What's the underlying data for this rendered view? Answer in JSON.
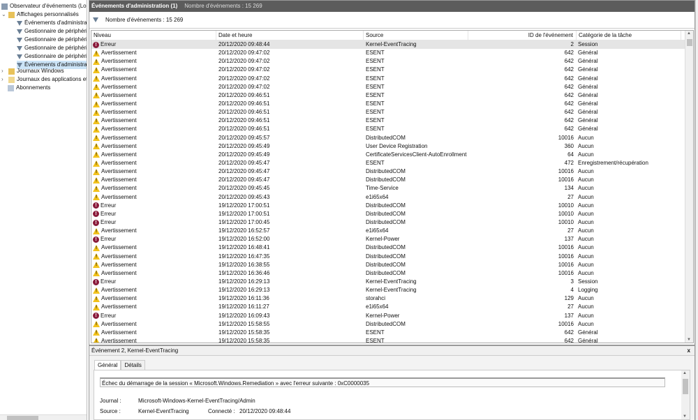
{
  "tree": {
    "root": "Observateur d'événements (Local)",
    "custom": "Affichages personnalisés",
    "custom_items": [
      "Événements d'administration",
      "Gestionnaire de périphériques",
      "Gestionnaire de périphériques",
      "Gestionnaire de périphériques",
      "Gestionnaire de périphériques",
      "Événements d'administration"
    ],
    "windows_logs": "Journaux Windows",
    "app_logs": "Journaux des applications et de services",
    "subscriptions": "Abonnements"
  },
  "header": {
    "title": "Événements d'administration (1)",
    "count": "Nombre d'événements : 15 269"
  },
  "filter": {
    "count": "Nombre d'événements : 15 269"
  },
  "columns": [
    "Niveau",
    "Date et heure",
    "Source",
    "ID de l'événement",
    "Catégorie de la tâche"
  ],
  "levels": {
    "err": "Erreur",
    "warn": "Avertissement"
  },
  "rows": [
    [
      "err",
      "20/12/2020 09:48:44",
      "Kernel-EventTracing",
      "2",
      "Session"
    ],
    [
      "warn",
      "20/12/2020 09:47:02",
      "ESENT",
      "642",
      "Général"
    ],
    [
      "warn",
      "20/12/2020 09:47:02",
      "ESENT",
      "642",
      "Général"
    ],
    [
      "warn",
      "20/12/2020 09:47:02",
      "ESENT",
      "642",
      "Général"
    ],
    [
      "warn",
      "20/12/2020 09:47:02",
      "ESENT",
      "642",
      "Général"
    ],
    [
      "warn",
      "20/12/2020 09:47:02",
      "ESENT",
      "642",
      "Général"
    ],
    [
      "warn",
      "20/12/2020 09:46:51",
      "ESENT",
      "642",
      "Général"
    ],
    [
      "warn",
      "20/12/2020 09:46:51",
      "ESENT",
      "642",
      "Général"
    ],
    [
      "warn",
      "20/12/2020 09:46:51",
      "ESENT",
      "642",
      "Général"
    ],
    [
      "warn",
      "20/12/2020 09:46:51",
      "ESENT",
      "642",
      "Général"
    ],
    [
      "warn",
      "20/12/2020 09:46:51",
      "ESENT",
      "642",
      "Général"
    ],
    [
      "warn",
      "20/12/2020 09:45:57",
      "DistributedCOM",
      "10016",
      "Aucun"
    ],
    [
      "warn",
      "20/12/2020 09:45:49",
      "User Device Registration",
      "360",
      "Aucun"
    ],
    [
      "warn",
      "20/12/2020 09:45:49",
      "CertificateServicesClient-AutoEnrollment",
      "64",
      "Aucun"
    ],
    [
      "warn",
      "20/12/2020 09:45:47",
      "ESENT",
      "472",
      "Enregistrement/récupération"
    ],
    [
      "warn",
      "20/12/2020 09:45:47",
      "DistributedCOM",
      "10016",
      "Aucun"
    ],
    [
      "warn",
      "20/12/2020 09:45:47",
      "DistributedCOM",
      "10016",
      "Aucun"
    ],
    [
      "warn",
      "20/12/2020 09:45:45",
      "Time-Service",
      "134",
      "Aucun"
    ],
    [
      "warn",
      "20/12/2020 09:45:43",
      "e1i65x64",
      "27",
      "Aucun"
    ],
    [
      "err",
      "19/12/2020 17:00:51",
      "DistributedCOM",
      "10010",
      "Aucun"
    ],
    [
      "err",
      "19/12/2020 17:00:51",
      "DistributedCOM",
      "10010",
      "Aucun"
    ],
    [
      "err",
      "19/12/2020 17:00:45",
      "DistributedCOM",
      "10010",
      "Aucun"
    ],
    [
      "warn",
      "19/12/2020 16:52:57",
      "e1i65x64",
      "27",
      "Aucun"
    ],
    [
      "err",
      "19/12/2020 16:52:00",
      "Kernel-Power",
      "137",
      "Aucun"
    ],
    [
      "warn",
      "19/12/2020 16:48:41",
      "DistributedCOM",
      "10016",
      "Aucun"
    ],
    [
      "warn",
      "19/12/2020 16:47:35",
      "DistributedCOM",
      "10016",
      "Aucun"
    ],
    [
      "warn",
      "19/12/2020 16:38:55",
      "DistributedCOM",
      "10016",
      "Aucun"
    ],
    [
      "warn",
      "19/12/2020 16:36:46",
      "DistributedCOM",
      "10016",
      "Aucun"
    ],
    [
      "err",
      "19/12/2020 16:29:13",
      "Kernel-EventTracing",
      "3",
      "Session"
    ],
    [
      "warn",
      "19/12/2020 16:29:13",
      "Kernel-EventTracing",
      "4",
      "Logging"
    ],
    [
      "warn",
      "19/12/2020 16:11:36",
      "storahci",
      "129",
      "Aucun"
    ],
    [
      "warn",
      "19/12/2020 16:11:27",
      "e1i65x64",
      "27",
      "Aucun"
    ],
    [
      "err",
      "19/12/2020 16:09:43",
      "Kernel-Power",
      "137",
      "Aucun"
    ],
    [
      "warn",
      "19/12/2020 15:58:55",
      "DistributedCOM",
      "10016",
      "Aucun"
    ],
    [
      "warn",
      "19/12/2020 15:58:35",
      "ESENT",
      "642",
      "Général"
    ],
    [
      "warn",
      "19/12/2020 15:58:35",
      "ESENT",
      "642",
      "Général"
    ]
  ],
  "detail": {
    "title": "Événement 2, Kernel-EventTracing",
    "close": "x",
    "tabs": [
      "Général",
      "Détails"
    ],
    "message": "Échec du démarrage de la session « Microsoft.Windows.Remediation » avec l'erreur suivante : 0xC0000035",
    "journal_label": "Journal :",
    "journal": "Microsoft-Windows-Kernel-EventTracing/Admin",
    "source_label": "Source :",
    "source": "Kernel-EventTracing",
    "logged_label": "Connecté :",
    "logged": "20/12/2020 09:48:44"
  }
}
